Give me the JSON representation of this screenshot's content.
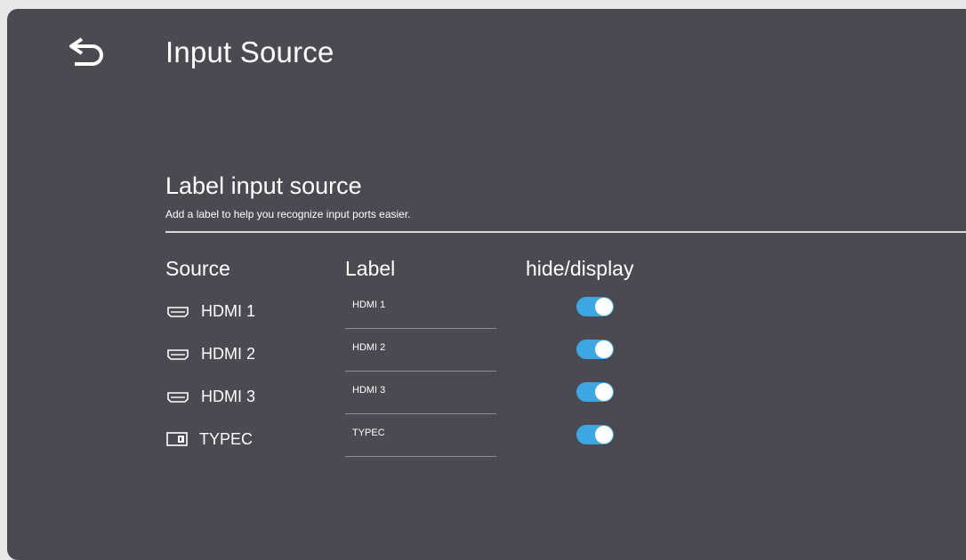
{
  "header": {
    "back_icon": "back-arrow-icon",
    "title": "Input Source"
  },
  "section": {
    "title": "Label input source",
    "subtitle": "Add a label to help you recognize input ports easier."
  },
  "columns": {
    "source": "Source",
    "label": "Label",
    "toggle": "hide/display"
  },
  "rows": [
    {
      "source": "HDMI 1",
      "label": "HDMI 1",
      "icon": "hdmi-port-icon",
      "display": true
    },
    {
      "source": "HDMI 2",
      "label": "HDMI 2",
      "icon": "hdmi-port-icon",
      "display": true
    },
    {
      "source": "HDMI 3",
      "label": "HDMI 3",
      "icon": "hdmi-port-icon",
      "display": true
    },
    {
      "source": "TYPEC",
      "label": "TYPEC",
      "icon": "typec-touch-icon",
      "display": true
    }
  ],
  "colors": {
    "panel": "#4b4a53",
    "accent": "#3ea6e2",
    "text": "#ffffff"
  }
}
